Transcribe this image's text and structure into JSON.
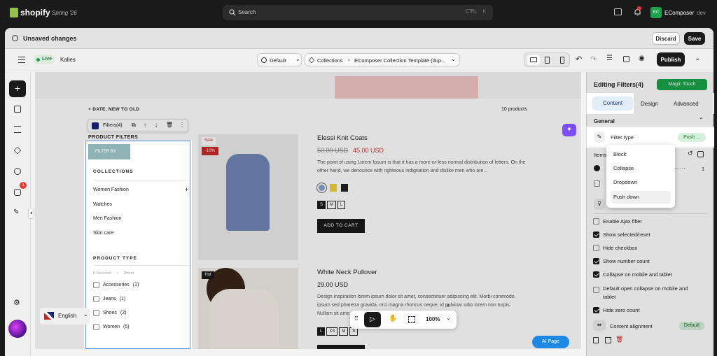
{
  "topbar": {
    "brand": "shopify",
    "edition": "Spring '26",
    "search_placeholder": "Search",
    "shortcut_ctrl": "CTRL",
    "shortcut_key": "K",
    "notif_count": "",
    "app_badge": "EC",
    "app_name": "EComposer",
    "app_tag": "dev"
  },
  "savebar": {
    "title": "Unsaved changes",
    "discard": "Discard",
    "save": "Save"
  },
  "toolbar": {
    "live": "Live",
    "store": "Kalles",
    "default_select": "Default",
    "breadcrumb_1": "Collections",
    "breadcrumb_2": "EComposer Collection Template (dup...",
    "publish": "Publish"
  },
  "leftrail": {
    "badge": "1",
    "language": "English"
  },
  "canvas": {
    "sort": "DATE, NEW TO OLD",
    "count": "10 products",
    "element_label": "Filters(4)",
    "filters_title": "PRODUCT FILTERS",
    "filter_by": "FILTER BY",
    "collections_title": "COLLECTIONS",
    "collections": [
      "Women Fashion",
      "Watches",
      "Men Fashion",
      "Skin care"
    ],
    "collections_expand": "+",
    "product_type_title": "PRODUCT TYPE",
    "selected": "0 Selected",
    "sep": "/",
    "reset": "Reset",
    "types": [
      {
        "name": "Accessories",
        "count": "(1)"
      },
      {
        "name": "Jeans",
        "count": "(1)"
      },
      {
        "name": "Shoes",
        "count": "(2)"
      },
      {
        "name": "Women",
        "count": "(5)"
      }
    ]
  },
  "products": [
    {
      "badge": "Sale",
      "discount": "-10%",
      "name": "Elessi Knit Coats",
      "old_price": "50.00 USD",
      "price": "45.00 USD",
      "desc": "The point of using Lorem Ipsum is that it has a more-or-less normal distribution of letters. On the other hand, we denounce with righteous indignation and dislike men who are...",
      "sizes": [
        "S",
        "M",
        "L"
      ],
      "cta": "ADD TO CART"
    },
    {
      "badge": "Hot",
      "name": "White Neck Pullover",
      "price": "29.00 USD",
      "desc": "Design inspiration lorem ipsum dolor sit amet, consectetuer adipiscing elit. Morbi commodo, ipsum sed pharetra gravida, orci magna rhoncus neque, id pulvinar odio lorem non turpis. Nullam sit ame",
      "sizes": [
        "L",
        "XS",
        "M",
        "S"
      ]
    }
  ],
  "floatbar": {
    "zoom": "100%",
    "close": "×"
  },
  "ai_page": "AI Page",
  "panel": {
    "title": "Editing Filters(4)",
    "magic": "Magic Touch",
    "tabs": [
      "Content",
      "Design",
      "Advanced"
    ],
    "section": "General",
    "filter_type_label": "Filter type",
    "filter_type_value": "Push ...",
    "items_label": "Items",
    "items_value": "1",
    "options": [
      "Block",
      "Collapse",
      "Dropdown",
      "Push down"
    ],
    "checks": [
      {
        "label": "Enable Ajax filter",
        "on": false
      },
      {
        "label": "Show selected/reset",
        "on": true
      },
      {
        "label": "Hide checkbox",
        "on": false
      },
      {
        "label": "Show number count",
        "on": true
      },
      {
        "label": "Collapse on mobile and tablet",
        "on": true
      },
      {
        "label": "Default open collapse on mobile and tablet",
        "on": false
      },
      {
        "label": "Hide zero count",
        "on": true
      }
    ],
    "alignment_label": "Content alignment",
    "alignment_value": "Default"
  }
}
